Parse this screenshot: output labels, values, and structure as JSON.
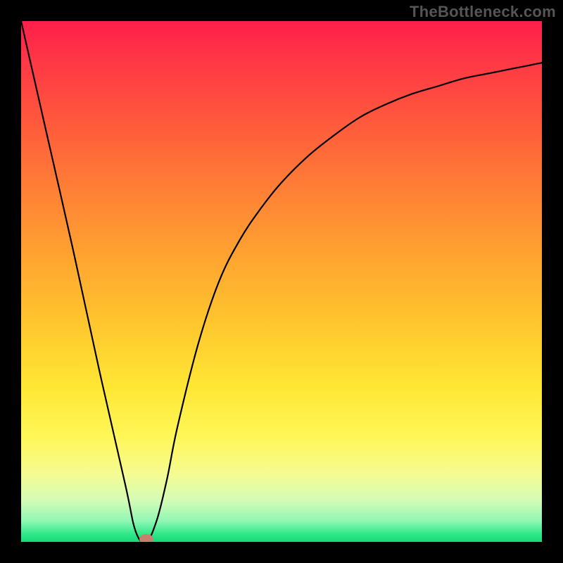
{
  "watermark": "TheBottleneck.com",
  "chart_data": {
    "type": "line",
    "title": "",
    "xlabel": "",
    "ylabel": "",
    "xlim": [
      0,
      100
    ],
    "ylim": [
      0,
      100
    ],
    "grid": false,
    "legend": false,
    "series": [
      {
        "name": "curve",
        "x": [
          0,
          5,
          10,
          15,
          20,
          22,
          24,
          26,
          28,
          30,
          34,
          38,
          42,
          46,
          50,
          55,
          60,
          65,
          70,
          75,
          80,
          85,
          90,
          95,
          100
        ],
        "y": [
          100,
          78,
          56,
          33,
          11,
          2,
          0,
          4,
          12,
          22,
          38,
          50,
          58,
          64,
          69,
          74,
          78,
          81.5,
          84,
          86,
          87.5,
          89,
          90,
          91,
          92
        ]
      }
    ],
    "marker": {
      "x": 24,
      "y": 0.5,
      "color": "#c5816d"
    },
    "background_gradient": {
      "top": "#ff1f4a",
      "mid": "#ffe634",
      "bottom": "#18d877"
    }
  }
}
